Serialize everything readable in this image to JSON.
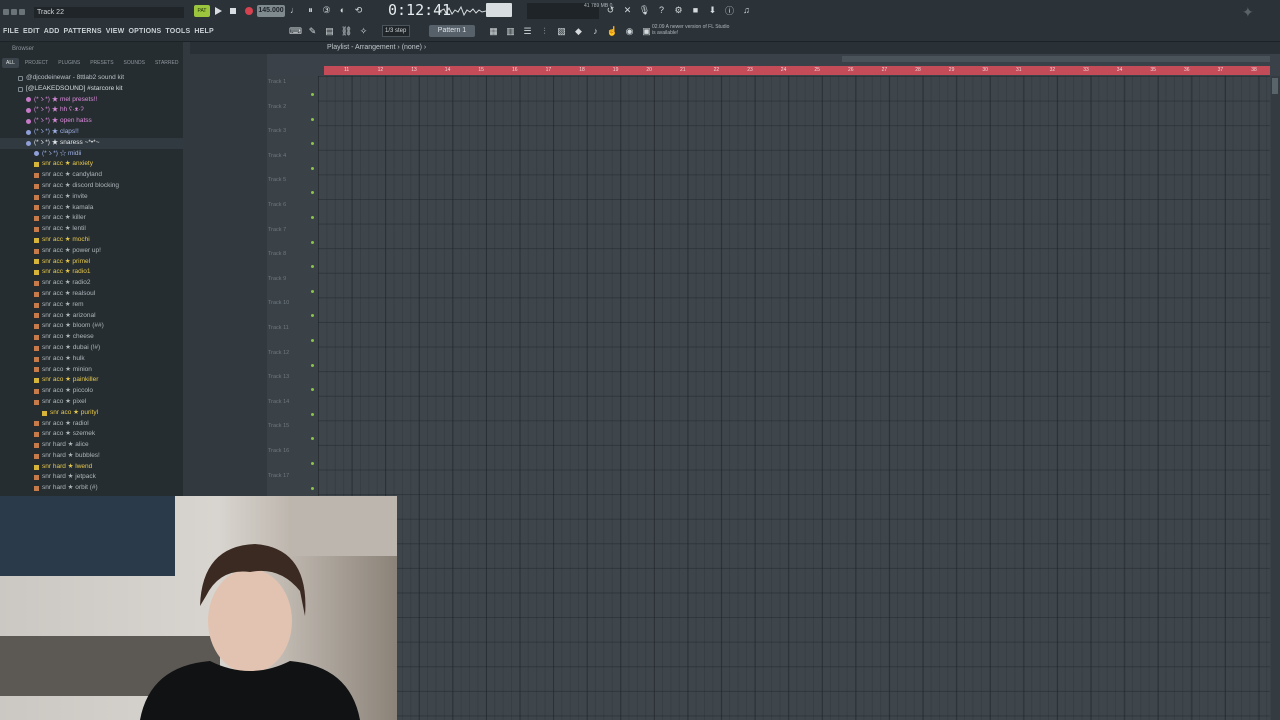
{
  "window": {
    "hint_text": "Track 22"
  },
  "menu": [
    "FILE",
    "EDIT",
    "ADD",
    "PATTERNS",
    "VIEW",
    "OPTIONS",
    "TOOLS",
    "HELP"
  ],
  "transport": {
    "pattern_song_label": "PAT",
    "tempo": "145.000",
    "time": "0:12:41",
    "snap_label": "1/3 step",
    "pattern_label": "Pattern 1",
    "cpu_value": "41",
    "mem_value": "789 MB",
    "voices": "0"
  },
  "news": {
    "date": "02.09",
    "text": "A newer version of FL Studio is available!"
  },
  "browser": {
    "header": "Browser",
    "tabs": [
      "ALL",
      "PROJECT",
      "PLUGINS",
      "PRESETS",
      "SOUNDS",
      "STARRED"
    ],
    "items": [
      {
        "label": "@djcodeinewar - 8ttlab2 sound kit",
        "kind": "folder",
        "color": "#b8c0c6",
        "indent": 1
      },
      {
        "label": "[@LEAKEDSOUND] #starcore kit",
        "kind": "folder",
        "color": "#d7dde0",
        "indent": 1
      },
      {
        "label": "(*ゝ*) ★ mel presets!!",
        "kind": "pink",
        "color": "#d98ad9",
        "indent": 2
      },
      {
        "label": "(*ゝ*) ★ hh ʕ·ᴥ·ʔ",
        "kind": "pink",
        "color": "#d98ad9",
        "indent": 2
      },
      {
        "label": "(*ゝ*) ★ open hatss",
        "kind": "pink",
        "color": "#d98ad9",
        "indent": 2
      },
      {
        "label": "(*ゝ*) ★ claps!!",
        "kind": "blue",
        "color": "#9fb2e8",
        "indent": 2
      },
      {
        "label": "(*ゝ*) ★ snaress ~*•*~",
        "kind": "blue",
        "color": "#e3e7ea",
        "indent": 2,
        "selected": true
      },
      {
        "label": "(*ゝ*) ☆ midii",
        "kind": "blue",
        "color": "#9fb2e8",
        "indent": 3
      },
      {
        "label": "snr acc ★ anxiety",
        "kind": "file-y",
        "color": "#e6c84a",
        "indent": 3
      },
      {
        "label": "snr acc ★ candyland",
        "kind": "file",
        "color": "#aeb6bb",
        "indent": 3
      },
      {
        "label": "snr acc ★ discord blocking",
        "kind": "file",
        "color": "#aeb6bb",
        "indent": 3
      },
      {
        "label": "snr acc ★ invite",
        "kind": "file",
        "color": "#aeb6bb",
        "indent": 3
      },
      {
        "label": "snr acc ★ kamala",
        "kind": "file",
        "color": "#aeb6bb",
        "indent": 3
      },
      {
        "label": "snr acc ★ killer",
        "kind": "file",
        "color": "#aeb6bb",
        "indent": 3
      },
      {
        "label": "snr acc ★ lentil",
        "kind": "file",
        "color": "#aeb6bb",
        "indent": 3
      },
      {
        "label": "snr acc ★ mochi",
        "kind": "file-y",
        "color": "#e6c84a",
        "indent": 3
      },
      {
        "label": "snr acc ★ power up!",
        "kind": "file",
        "color": "#aeb6bb",
        "indent": 3
      },
      {
        "label": "snr acc ★ primel",
        "kind": "file-y",
        "color": "#e6c84a",
        "indent": 3
      },
      {
        "label": "snr acc ★ radio1",
        "kind": "file-y",
        "color": "#e6c84a",
        "indent": 3
      },
      {
        "label": "snr acc ★ radio2",
        "kind": "file",
        "color": "#aeb6bb",
        "indent": 3
      },
      {
        "label": "snr acc ★ realsoul",
        "kind": "file",
        "color": "#aeb6bb",
        "indent": 3
      },
      {
        "label": "snr acc ★ rem",
        "kind": "file",
        "color": "#aeb6bb",
        "indent": 3
      },
      {
        "label": "snr aco ★ arizonal",
        "kind": "file",
        "color": "#aeb6bb",
        "indent": 3
      },
      {
        "label": "snr aco ★ bloom (##)",
        "kind": "file",
        "color": "#aeb6bb",
        "indent": 3
      },
      {
        "label": "snr aco ★ cheese",
        "kind": "file",
        "color": "#aeb6bb",
        "indent": 3
      },
      {
        "label": "snr aco ★ dubai (!#)",
        "kind": "file",
        "color": "#aeb6bb",
        "indent": 3
      },
      {
        "label": "snr aco ★ hulk",
        "kind": "file",
        "color": "#aeb6bb",
        "indent": 3
      },
      {
        "label": "snr aco ★ minion",
        "kind": "file",
        "color": "#aeb6bb",
        "indent": 3
      },
      {
        "label": "snr aco ★ painkiller",
        "kind": "file-y",
        "color": "#e6c84a",
        "indent": 3
      },
      {
        "label": "snr aco ★ piccolo",
        "kind": "file",
        "color": "#aeb6bb",
        "indent": 3
      },
      {
        "label": "snr aco ★ pixel",
        "kind": "file",
        "color": "#aeb6bb",
        "indent": 3
      },
      {
        "label": "snr aco ★ purityl",
        "kind": "file-y",
        "color": "#e6c84a",
        "indent": 4
      },
      {
        "label": "snr aco ★ radiol",
        "kind": "file",
        "color": "#aeb6bb",
        "indent": 3
      },
      {
        "label": "snr aco ★ szemek",
        "kind": "file",
        "color": "#aeb6bb",
        "indent": 3
      },
      {
        "label": "snr hard ★ alice",
        "kind": "file",
        "color": "#aeb6bb",
        "indent": 3
      },
      {
        "label": "snr hard ★ bubbles!",
        "kind": "file",
        "color": "#aeb6bb",
        "indent": 3
      },
      {
        "label": "snr hard ★ lwend",
        "kind": "file-y",
        "color": "#e6c84a",
        "indent": 3
      },
      {
        "label": "snr hard ★ jetpack",
        "kind": "file",
        "color": "#aeb6bb",
        "indent": 3
      },
      {
        "label": "snr hard ★ orbit (#)",
        "kind": "file",
        "color": "#aeb6bb",
        "indent": 3
      }
    ]
  },
  "playlist": {
    "title": "Playlist - Arrangement › (none) ›",
    "tracks": [
      "Track 1",
      "Track 2",
      "Track 3",
      "Track 4",
      "Track 5",
      "Track 6",
      "Track 7",
      "Track 8",
      "Track 9",
      "Track 10",
      "Track 11",
      "Track 12",
      "Track 13",
      "Track 14",
      "Track 15",
      "Track 16",
      "Track 17"
    ],
    "bars": [
      "11",
      "12",
      "13",
      "14",
      "15",
      "16",
      "17",
      "18",
      "19",
      "20",
      "21",
      "22",
      "23",
      "24",
      "25",
      "26",
      "27",
      "28",
      "29",
      "30",
      "31",
      "32",
      "33",
      "34",
      "35",
      "36",
      "37",
      "38"
    ],
    "colors": {
      "ruler": "#c44b58",
      "led": "#8bc34a"
    }
  },
  "icons": {
    "toolbar1": [
      "metronome-icon",
      "wait-icon",
      "countdown-icon",
      "blend-icon",
      "loop-record-icon"
    ],
    "toolbar2": [
      "keyboard-icon",
      "typing-icon",
      "step-edit-icon",
      "link-icon",
      "hint-icon"
    ],
    "views": [
      "playlist-icon",
      "piano-roll-icon",
      "channel-rack-icon",
      "mixer-icon",
      "browser-icon",
      "plugin-icon",
      "plugin-picker-icon",
      "touch-icon",
      "tempo-tapper-icon",
      "capture-icon"
    ],
    "right": [
      "undo-icon",
      "x-icon",
      "mic-icon",
      "help-icon",
      "settings-icon",
      "stop-icon",
      "download-icon",
      "info-icon",
      "bell-icon"
    ]
  }
}
